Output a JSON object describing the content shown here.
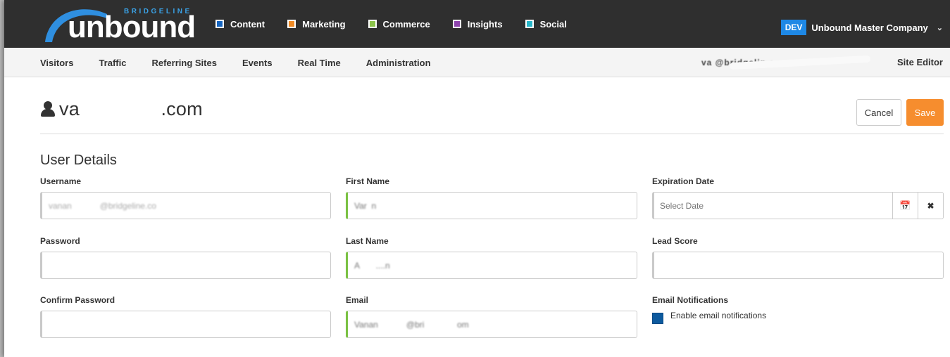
{
  "brand": {
    "logo_top": "BRIDGELINE",
    "logo_word": "unbound"
  },
  "modules": [
    {
      "label": "Content",
      "color": "#1565c0"
    },
    {
      "label": "Marketing",
      "color": "#f08a24"
    },
    {
      "label": "Commerce",
      "color": "#8bc34a"
    },
    {
      "label": "Insights",
      "color": "#8e44ad"
    },
    {
      "label": "Social",
      "color": "#26b6c9"
    }
  ],
  "company": {
    "badge": "DEV",
    "name": "Unbound Master Company",
    "chevron": "⌄"
  },
  "subnav": {
    "items": [
      "Visitors",
      "Traffic",
      "Referring Sites",
      "Events",
      "Real Time",
      "Administration"
    ],
    "user": "va                   @bridgelin   co",
    "site_editor": "Site Editor"
  },
  "header": {
    "title_prefix": "va",
    "title_obscured": "               ",
    "title_suffix": ".com",
    "cancel": "Cancel",
    "save": "Save"
  },
  "section": {
    "title": "User Details"
  },
  "form": {
    "username_label": "Username",
    "username_value": "vanan            @bridgeline.co",
    "password_label": "Password",
    "confirm_label": "Confirm Password",
    "first_name_label": "First Name",
    "first_name_value": "Var  n",
    "last_name_label": "Last Name",
    "last_name_value": "A       ....n",
    "email_label": "Email",
    "email_value": "Vanan            @bri              om",
    "expiration_label": "Expiration Date",
    "expiration_placeholder": "Select Date",
    "calendar_icon": "📅",
    "clear_icon": "✖",
    "lead_score_label": "Lead Score",
    "email_notifications_label": "Email Notifications",
    "enable_notifications": "Enable email notifications"
  }
}
